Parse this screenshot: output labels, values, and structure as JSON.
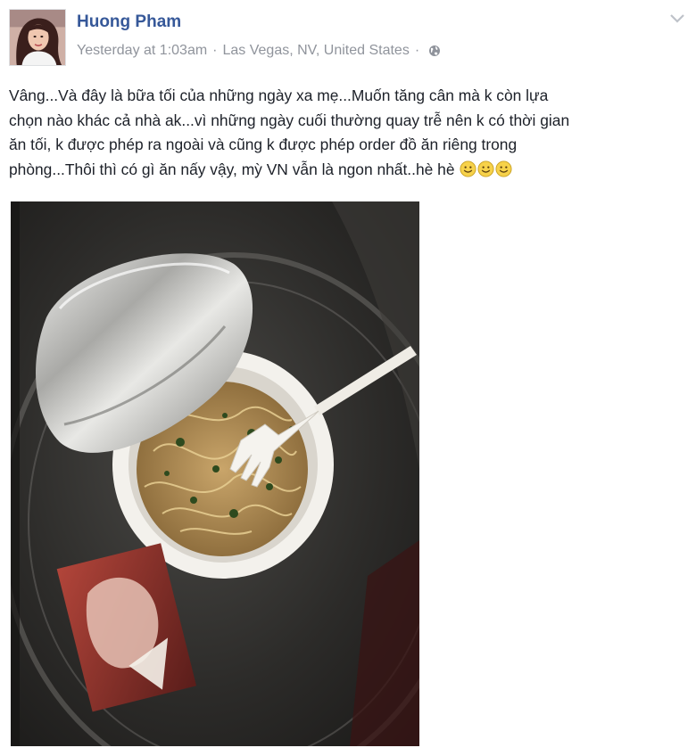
{
  "post": {
    "author_name": "Huong Pham",
    "timestamp": "Yesterday at 1:03am",
    "separator": "·",
    "location": "Las Vegas, NV, United States",
    "privacy_icon": "globe-icon",
    "menu_icon": "chevron-down-icon",
    "text_lines": [
      "Vâng...Và đây là bữa tối của những ngày xa mẹ...Muốn tăng cân mà k còn lựa",
      "chọn nào khác cả nhà ak...vì những ngày cuối thường quay trễ nên k có thời gian",
      "ăn tối, k được phép ra ngoài và cũng k được phép order đồ ăn riêng trong",
      "phòng...Thôi thì có gì ăn nấy vậy, mỳ VN vẫn là ngon nhất..hè hè"
    ],
    "emoji_icons": [
      "smiley-icon",
      "smiley-icon",
      "smiley-icon"
    ],
    "photo": "instant-noodle-cup-photo"
  },
  "colors": {
    "author": "#365899",
    "meta": "#90949c",
    "text": "#1d2129"
  }
}
